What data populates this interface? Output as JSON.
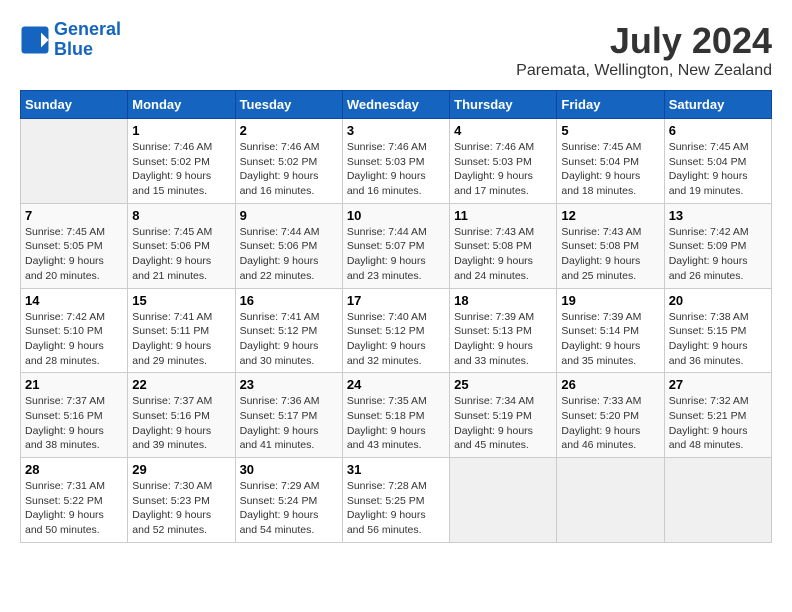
{
  "header": {
    "logo_line1": "General",
    "logo_line2": "Blue",
    "title": "July 2024",
    "subtitle": "Paremata, Wellington, New Zealand"
  },
  "calendar": {
    "weekdays": [
      "Sunday",
      "Monday",
      "Tuesday",
      "Wednesday",
      "Thursday",
      "Friday",
      "Saturday"
    ],
    "weeks": [
      [
        {
          "day": "",
          "empty": true
        },
        {
          "day": "1",
          "sunrise": "7:46 AM",
          "sunset": "5:02 PM",
          "daylight": "9 hours and 15 minutes."
        },
        {
          "day": "2",
          "sunrise": "7:46 AM",
          "sunset": "5:02 PM",
          "daylight": "9 hours and 16 minutes."
        },
        {
          "day": "3",
          "sunrise": "7:46 AM",
          "sunset": "5:03 PM",
          "daylight": "9 hours and 16 minutes."
        },
        {
          "day": "4",
          "sunrise": "7:46 AM",
          "sunset": "5:03 PM",
          "daylight": "9 hours and 17 minutes."
        },
        {
          "day": "5",
          "sunrise": "7:45 AM",
          "sunset": "5:04 PM",
          "daylight": "9 hours and 18 minutes."
        },
        {
          "day": "6",
          "sunrise": "7:45 AM",
          "sunset": "5:04 PM",
          "daylight": "9 hours and 19 minutes."
        }
      ],
      [
        {
          "day": "7",
          "sunrise": "7:45 AM",
          "sunset": "5:05 PM",
          "daylight": "9 hours and 20 minutes."
        },
        {
          "day": "8",
          "sunrise": "7:45 AM",
          "sunset": "5:06 PM",
          "daylight": "9 hours and 21 minutes."
        },
        {
          "day": "9",
          "sunrise": "7:44 AM",
          "sunset": "5:06 PM",
          "daylight": "9 hours and 22 minutes."
        },
        {
          "day": "10",
          "sunrise": "7:44 AM",
          "sunset": "5:07 PM",
          "daylight": "9 hours and 23 minutes."
        },
        {
          "day": "11",
          "sunrise": "7:43 AM",
          "sunset": "5:08 PM",
          "daylight": "9 hours and 24 minutes."
        },
        {
          "day": "12",
          "sunrise": "7:43 AM",
          "sunset": "5:08 PM",
          "daylight": "9 hours and 25 minutes."
        },
        {
          "day": "13",
          "sunrise": "7:42 AM",
          "sunset": "5:09 PM",
          "daylight": "9 hours and 26 minutes."
        }
      ],
      [
        {
          "day": "14",
          "sunrise": "7:42 AM",
          "sunset": "5:10 PM",
          "daylight": "9 hours and 28 minutes."
        },
        {
          "day": "15",
          "sunrise": "7:41 AM",
          "sunset": "5:11 PM",
          "daylight": "9 hours and 29 minutes."
        },
        {
          "day": "16",
          "sunrise": "7:41 AM",
          "sunset": "5:12 PM",
          "daylight": "9 hours and 30 minutes."
        },
        {
          "day": "17",
          "sunrise": "7:40 AM",
          "sunset": "5:12 PM",
          "daylight": "9 hours and 32 minutes."
        },
        {
          "day": "18",
          "sunrise": "7:39 AM",
          "sunset": "5:13 PM",
          "daylight": "9 hours and 33 minutes."
        },
        {
          "day": "19",
          "sunrise": "7:39 AM",
          "sunset": "5:14 PM",
          "daylight": "9 hours and 35 minutes."
        },
        {
          "day": "20",
          "sunrise": "7:38 AM",
          "sunset": "5:15 PM",
          "daylight": "9 hours and 36 minutes."
        }
      ],
      [
        {
          "day": "21",
          "sunrise": "7:37 AM",
          "sunset": "5:16 PM",
          "daylight": "9 hours and 38 minutes."
        },
        {
          "day": "22",
          "sunrise": "7:37 AM",
          "sunset": "5:16 PM",
          "daylight": "9 hours and 39 minutes."
        },
        {
          "day": "23",
          "sunrise": "7:36 AM",
          "sunset": "5:17 PM",
          "daylight": "9 hours and 41 minutes."
        },
        {
          "day": "24",
          "sunrise": "7:35 AM",
          "sunset": "5:18 PM",
          "daylight": "9 hours and 43 minutes."
        },
        {
          "day": "25",
          "sunrise": "7:34 AM",
          "sunset": "5:19 PM",
          "daylight": "9 hours and 45 minutes."
        },
        {
          "day": "26",
          "sunrise": "7:33 AM",
          "sunset": "5:20 PM",
          "daylight": "9 hours and 46 minutes."
        },
        {
          "day": "27",
          "sunrise": "7:32 AM",
          "sunset": "5:21 PM",
          "daylight": "9 hours and 48 minutes."
        }
      ],
      [
        {
          "day": "28",
          "sunrise": "7:31 AM",
          "sunset": "5:22 PM",
          "daylight": "9 hours and 50 minutes."
        },
        {
          "day": "29",
          "sunrise": "7:30 AM",
          "sunset": "5:23 PM",
          "daylight": "9 hours and 52 minutes."
        },
        {
          "day": "30",
          "sunrise": "7:29 AM",
          "sunset": "5:24 PM",
          "daylight": "9 hours and 54 minutes."
        },
        {
          "day": "31",
          "sunrise": "7:28 AM",
          "sunset": "5:25 PM",
          "daylight": "9 hours and 56 minutes."
        },
        {
          "day": "",
          "empty": true
        },
        {
          "day": "",
          "empty": true
        },
        {
          "day": "",
          "empty": true
        }
      ]
    ]
  }
}
